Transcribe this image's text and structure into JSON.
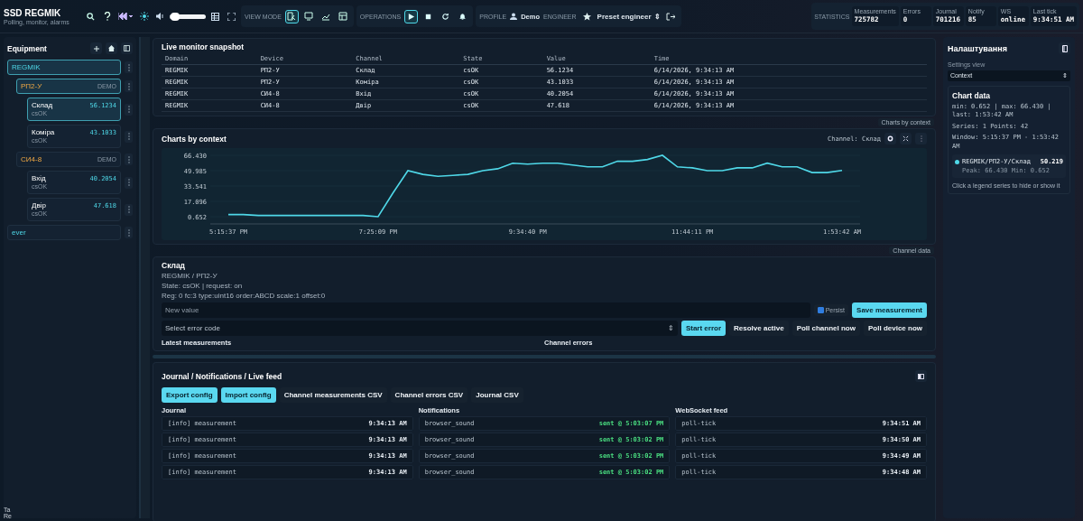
{
  "header": {
    "title": "SSD REGMIK",
    "subtitle": "Polling, monitor, alarms",
    "volume": {
      "level": 0.15
    },
    "view_mode": {
      "label": "VIEW MODE",
      "buttons": [
        {
          "selected": true
        },
        {
          "selected": false
        },
        {
          "selected": false
        },
        {
          "selected": false
        }
      ]
    },
    "operations": {
      "label": "OPERATIONS",
      "buttons": [
        {
          "kind": "play",
          "selected": true
        },
        {
          "kind": "stop",
          "selected": false
        },
        {
          "kind": "refresh",
          "selected": false
        },
        {
          "kind": "bell",
          "selected": false
        }
      ]
    },
    "profile": {
      "label": "PROFILE",
      "user": "Demo",
      "role": "ENGINEER",
      "preset": "Preset engineer",
      "preset_arrow": "⇕"
    },
    "statistics": {
      "label": "STATISTICS",
      "cells": [
        {
          "label": "Measurements",
          "value": "725782"
        },
        {
          "label": "Errors",
          "value": "0"
        },
        {
          "label": "Journal",
          "value": "701216"
        },
        {
          "label": "Notify",
          "value": "85"
        },
        {
          "label": "WS",
          "value": "online"
        },
        {
          "label": "Last tick",
          "value": "9:34:51 AM"
        }
      ]
    }
  },
  "sidebar": {
    "title": "Equipment",
    "tree": [
      {
        "name": "REGMIK",
        "selected": true,
        "children": [
          {
            "name": "РП2-У",
            "badge": "DEMO",
            "selected": true,
            "children": [
              {
                "name": "Склад",
                "state": "csOK",
                "value": "56.1234",
                "selected": true
              },
              {
                "name": "Коміра",
                "state": "csOK",
                "value": "43.1033",
                "selected": false
              }
            ]
          },
          {
            "name": "СИ4-8",
            "badge": "DEMO",
            "selected": false,
            "children": [
              {
                "name": "Вхід",
                "state": "csOK",
                "value": "40.2054",
                "selected": false
              },
              {
                "name": "Двір",
                "state": "csOK",
                "value": "47.618",
                "selected": false
              }
            ]
          }
        ]
      },
      {
        "name": "ever",
        "selected": false
      }
    ]
  },
  "snapshot": {
    "title": "Live monitor snapshot",
    "columns": [
      "Domain",
      "Device",
      "Channel",
      "State",
      "Value",
      "Time"
    ],
    "rows": [
      [
        "REGMIK",
        "РП2-У",
        "Склад",
        "csOK",
        "56.1234",
        "6/14/2026, 9:34:13 AM"
      ],
      [
        "REGMIK",
        "РП2-У",
        "Коміра",
        "csOK",
        "43.1033",
        "6/14/2026, 9:34:13 AM"
      ],
      [
        "REGMIK",
        "СИ4-8",
        "Вхід",
        "csOK",
        "40.2054",
        "6/14/2026, 9:34:13 AM"
      ],
      [
        "REGMIK",
        "СИ4-8",
        "Двір",
        "csOK",
        "47.618",
        "6/14/2026, 9:34:13 AM"
      ]
    ],
    "link": "Charts by context"
  },
  "charts": {
    "title": "Charts by context",
    "channel": "Channel: Склад",
    "link": "Channel data",
    "chart_data": {
      "type": "line",
      "categories": [
        "5:15:37 PM",
        null,
        null,
        null,
        null,
        null,
        null,
        null,
        null,
        null,
        "7:25:09 PM",
        null,
        null,
        null,
        null,
        null,
        null,
        null,
        null,
        null,
        "9:34:40 PM",
        null,
        null,
        null,
        null,
        null,
        null,
        null,
        null,
        null,
        null,
        "11:44:11 PM",
        null,
        null,
        null,
        null,
        null,
        null,
        null,
        null,
        null,
        "1:53:42 AM"
      ],
      "yticks": [
        {
          "value": 0.652,
          "label": "0.652"
        },
        {
          "value": 17.096,
          "label": "17.096"
        },
        {
          "value": 33.541,
          "label": "33.541"
        },
        {
          "value": 49.985,
          "label": "49.985"
        },
        {
          "value": 66.43,
          "label": "66.430"
        }
      ],
      "ylim": [
        0.652,
        66.43
      ],
      "series": [
        {
          "name": "REGMIK/РП2-У/Склад",
          "color": "#4fd8e8",
          "values": [
            3,
            3,
            2,
            2,
            2,
            2,
            2,
            2,
            2,
            2,
            0.652,
            26,
            50,
            46,
            44,
            45,
            46,
            50,
            52,
            58,
            57,
            58,
            58,
            56,
            54,
            54,
            60,
            60,
            62,
            66.43,
            54,
            53,
            50,
            50,
            53,
            53,
            58,
            54,
            54,
            48,
            48,
            50.219
          ]
        }
      ]
    }
  },
  "detail": {
    "title": "Склад",
    "path": "REGMIK / РП2-У",
    "state": "State: csOK | request: on",
    "reg": "Reg: 0 fc:3 type:uint16 order:ABCD scale:1 offset:0"
  },
  "form": {
    "value_placeholder": "New value",
    "persist": {
      "label": "Persist",
      "checked": true
    },
    "save": "Save measurement",
    "error_placeholder": "Select error code",
    "select_arrow": "⇕",
    "buttons": [
      {
        "label": "Start error",
        "kind": "primary"
      },
      {
        "label": "Resolve active",
        "kind": "plain"
      },
      {
        "label": "Poll channel now",
        "kind": "plain"
      },
      {
        "label": "Poll device now",
        "kind": "plain"
      }
    ],
    "latest": "Latest measurements",
    "errors": "Channel errors"
  },
  "feed": {
    "title": "Journal / Notifications / Live feed",
    "buttons": [
      {
        "label": "Export config",
        "kind": "primary"
      },
      {
        "label": "Import config",
        "kind": "primary"
      },
      {
        "label": "Channel measurements CSV",
        "kind": "plain"
      },
      {
        "label": "Channel errors CSV",
        "kind": "plain"
      },
      {
        "label": "Journal CSV",
        "kind": "plain"
      }
    ],
    "lists": [
      {
        "title": "Journal",
        "items": [
          {
            "text": "[info] measurement",
            "time": "9:34:13 AM"
          },
          {
            "text": "[info] measurement",
            "time": "9:34:13 AM"
          },
          {
            "text": "[info] measurement",
            "time": "9:34:13 AM"
          },
          {
            "text": "[info] measurement",
            "time": "9:34:13 AM"
          }
        ]
      },
      {
        "title": "Notifications",
        "items": [
          {
            "text": "browser_sound",
            "time": "sent @ 5:03:07 PM",
            "kind": "sent"
          },
          {
            "text": "browser_sound",
            "time": "sent @ 5:03:02 PM",
            "kind": "sent"
          },
          {
            "text": "browser_sound",
            "time": "sent @ 5:03:02 PM",
            "kind": "sent"
          },
          {
            "text": "browser_sound",
            "time": "sent @ 5:03:02 PM",
            "kind": "sent"
          }
        ]
      },
      {
        "title": "WebSocket feed",
        "items": [
          {
            "text": "poll-tick",
            "time": "9:34:51 AM"
          },
          {
            "text": "poll-tick",
            "time": "9:34:50 AM"
          },
          {
            "text": "poll-tick",
            "time": "9:34:49 AM"
          },
          {
            "text": "poll-tick",
            "time": "9:34:48 AM"
          }
        ]
      }
    ]
  },
  "settings": {
    "title": "Налаштування",
    "view_label": "Settings view",
    "view": "Context",
    "view_arrow": "⇕",
    "chart_data_title": "Chart data",
    "stats": "min: 0.652 | max: 66.430 | last: 1:53:42 AM",
    "series": "Series: 1 Points: 42",
    "window": "Window: 5:15:37 PM - 1:53:42 AM",
    "legend": [
      {
        "value": "50.219",
        "detail": "Peak: 66.430 Min: 0.652"
      }
    ],
    "hint": "Click a legend series to hide or show it"
  },
  "corner": "Ta Re"
}
